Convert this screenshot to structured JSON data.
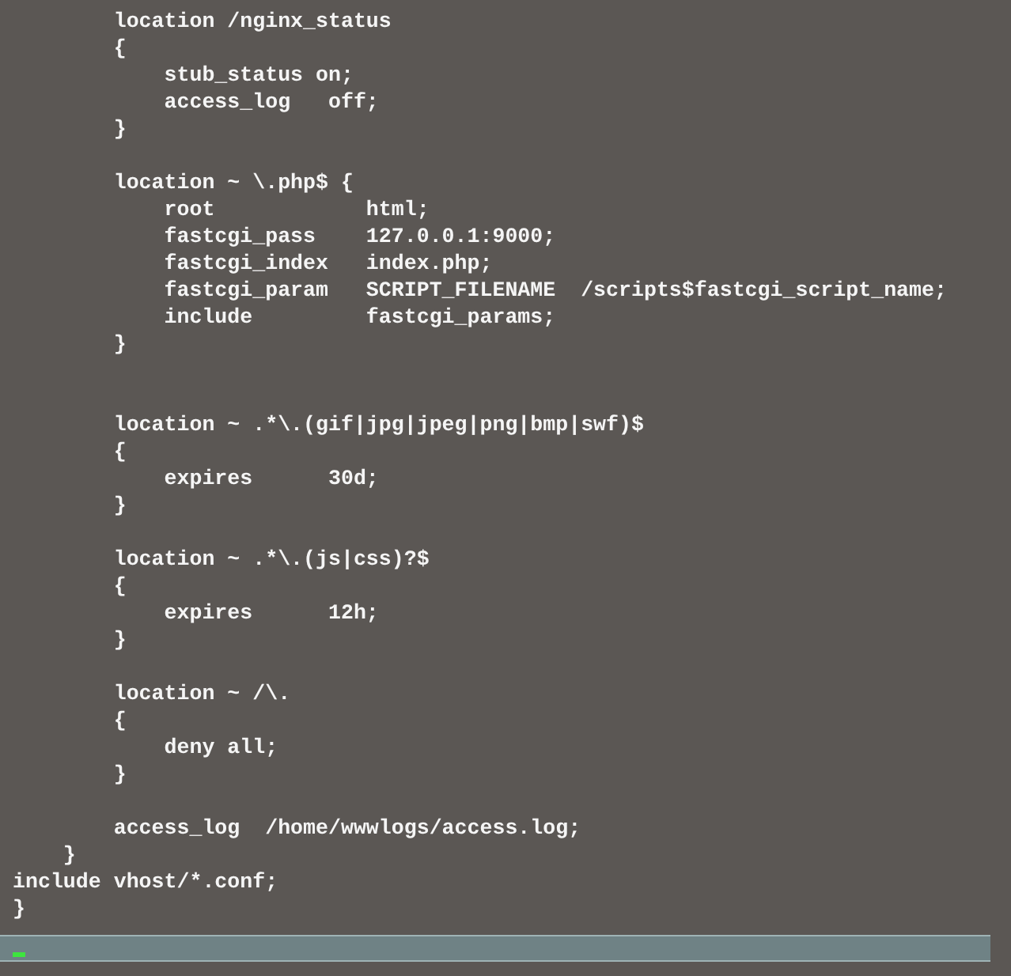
{
  "terminal": {
    "lines": [
      {
        "kind": "code",
        "text": "        location /nginx_status"
      },
      {
        "kind": "code",
        "text": "        {"
      },
      {
        "kind": "code",
        "text": "            stub_status on;"
      },
      {
        "kind": "code",
        "text": "            access_log   off;"
      },
      {
        "kind": "code",
        "text": "        }"
      },
      {
        "kind": "blank"
      },
      {
        "kind": "code",
        "text": "        location ~ \\.php$ {"
      },
      {
        "kind": "code",
        "text": "            root            html;"
      },
      {
        "kind": "code",
        "text": "            fastcgi_pass    127.0.0.1:9000;"
      },
      {
        "kind": "code",
        "text": "            fastcgi_index   index.php;"
      },
      {
        "kind": "code",
        "text": "            fastcgi_param   SCRIPT_FILENAME  /scripts$fastcgi_script_name;"
      },
      {
        "kind": "code",
        "text": "            include         fastcgi_params;"
      },
      {
        "kind": "code",
        "text": "        }"
      },
      {
        "kind": "blank"
      },
      {
        "kind": "blank"
      },
      {
        "kind": "code",
        "text": "        location ~ .*\\.(gif|jpg|jpeg|png|bmp|swf)$"
      },
      {
        "kind": "code",
        "text": "        {"
      },
      {
        "kind": "code",
        "text": "            expires      30d;"
      },
      {
        "kind": "code",
        "text": "        }"
      },
      {
        "kind": "blank"
      },
      {
        "kind": "code",
        "text": "        location ~ .*\\.(js|css)?$"
      },
      {
        "kind": "code",
        "text": "        {"
      },
      {
        "kind": "code",
        "text": "            expires      12h;"
      },
      {
        "kind": "code",
        "text": "        }"
      },
      {
        "kind": "blank"
      },
      {
        "kind": "code",
        "text": "        location ~ /\\."
      },
      {
        "kind": "code",
        "text": "        {"
      },
      {
        "kind": "code",
        "text": "            deny all;"
      },
      {
        "kind": "code",
        "text": "        }"
      },
      {
        "kind": "blank"
      },
      {
        "kind": "code",
        "text": "        access_log  /home/wwwlogs/access.log;"
      },
      {
        "kind": "code",
        "text": "    }"
      },
      {
        "kind": "code",
        "text": "include vhost/*.conf;"
      },
      {
        "kind": "code",
        "text": "}"
      }
    ]
  }
}
